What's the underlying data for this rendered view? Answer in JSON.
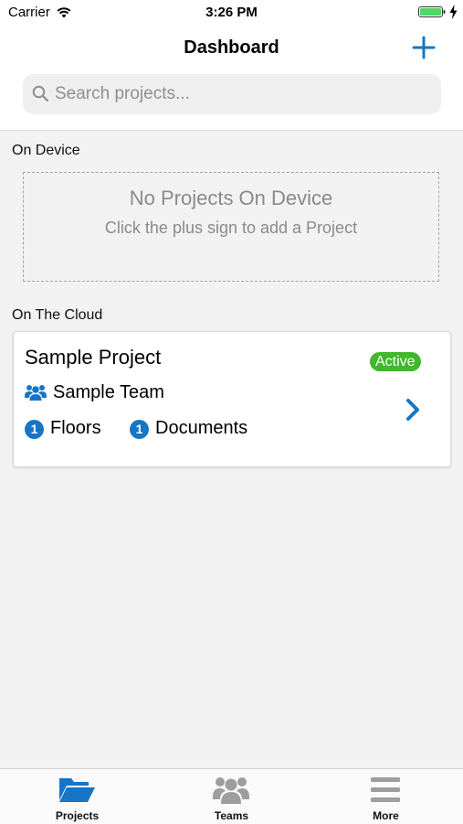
{
  "status_bar": {
    "carrier": "Carrier",
    "time": "3:26 PM"
  },
  "nav": {
    "title": "Dashboard"
  },
  "search": {
    "placeholder": "Search projects..."
  },
  "sections": {
    "on_device": {
      "header": "On Device",
      "empty_title": "No Projects On Device",
      "empty_subtitle": "Click the plus sign to add a Project"
    },
    "on_cloud": {
      "header": "On The Cloud"
    }
  },
  "projects": [
    {
      "name": "Sample Project",
      "status": "Active",
      "team": "Sample Team",
      "floors_count": "1",
      "floors_label": "Floors",
      "documents_count": "1",
      "documents_label": "Documents"
    }
  ],
  "tabs": [
    {
      "label": "Projects",
      "icon": "folder-open-icon",
      "active": true
    },
    {
      "label": "Teams",
      "icon": "users-icon",
      "active": false
    },
    {
      "label": "More",
      "icon": "menu-icon",
      "active": false
    }
  ],
  "colors": {
    "accent": "#1775c6",
    "active_badge": "#3fb82b",
    "inactive_tab": "#9e9e9e",
    "battery": "#4cd964"
  }
}
